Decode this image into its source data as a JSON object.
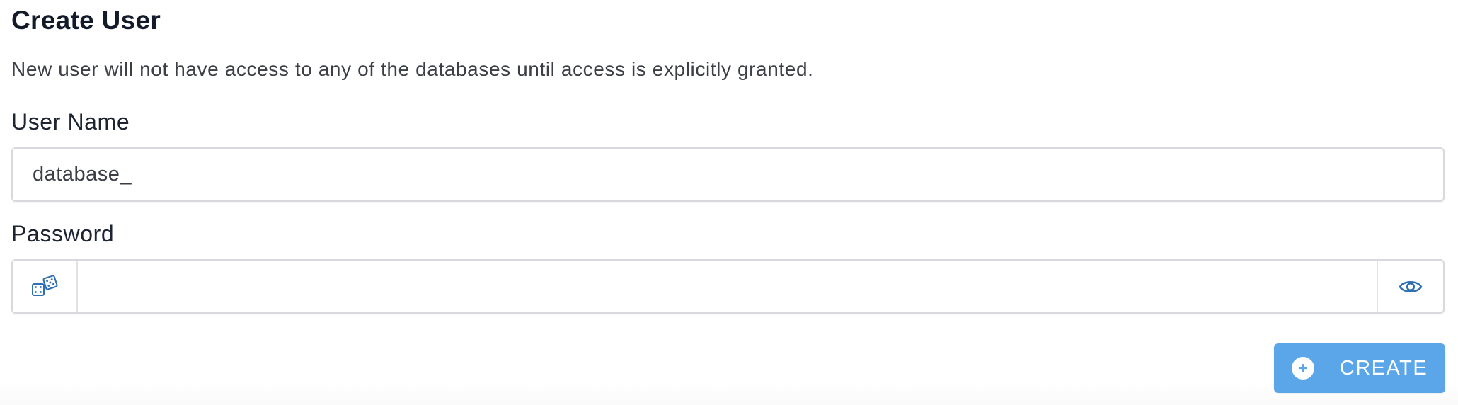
{
  "form": {
    "title": "Create User",
    "description": "New user will not have access to any of the databases until access is explicitly granted.",
    "username": {
      "label": "User Name",
      "prefix": "database_",
      "value": "",
      "placeholder": ""
    },
    "password": {
      "label": "Password",
      "value": "",
      "placeholder": "",
      "generate_icon": "dice-icon",
      "toggle_icon": "eye-icon"
    },
    "create_button": {
      "label": "CREATE",
      "icon": "plus-circle-icon"
    }
  },
  "colors": {
    "accent": "#5aa6e8",
    "icon": "#2f6fb4",
    "border": "#d7d9dc",
    "title": "#131a2a",
    "text": "#3c3f46"
  }
}
